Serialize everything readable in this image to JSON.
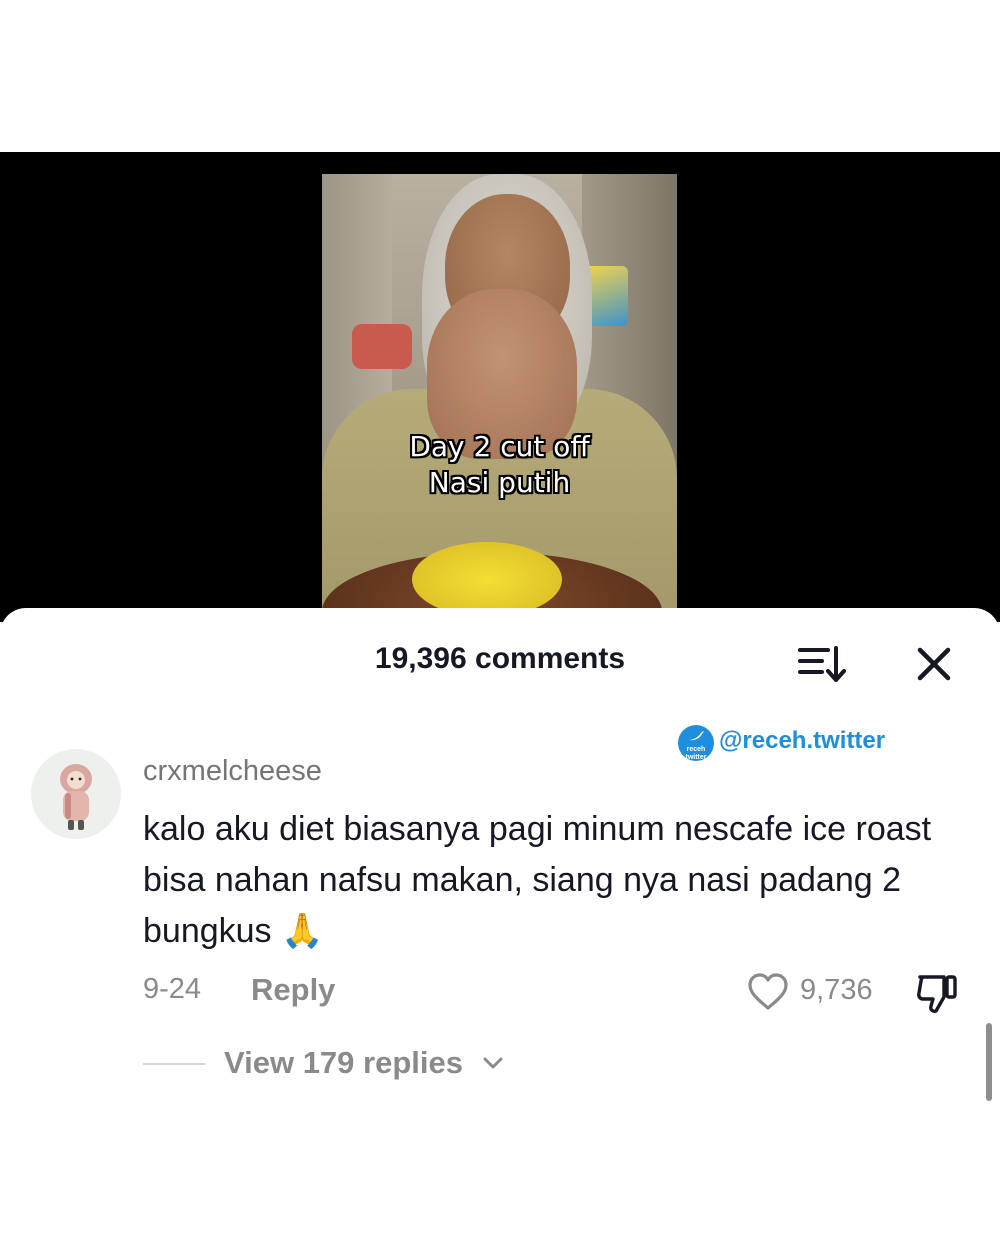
{
  "video": {
    "caption_line1": "Day 2 cut off",
    "caption_line2": "Nasi putih"
  },
  "comments_header": {
    "count_label": "19,396 comments",
    "sort_icon": "sort-icon",
    "close_icon": "close-icon"
  },
  "watermark": {
    "badge_text": "receh twitter",
    "handle": "@receh.twitter",
    "color": "#1e8fdc"
  },
  "comment": {
    "username": "crxmelcheese",
    "text": "kalo aku diet biasanya pagi minum nescafe ice roast bisa nahan nafsu makan, siang nya nasi padang 2 bungkus 🙏",
    "date": "9-24",
    "reply_label": "Reply",
    "like_count": "9,736",
    "view_replies_label": "View 179 replies"
  },
  "colors": {
    "text_primary": "#161823",
    "text_secondary": "#8a8a8a",
    "video_background": "#000000"
  }
}
